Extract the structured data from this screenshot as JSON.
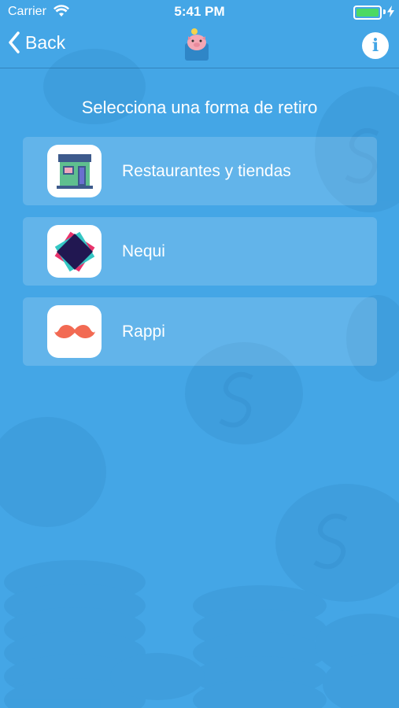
{
  "status_bar": {
    "carrier": "Carrier",
    "time": "5:41 PM",
    "battery_level": 1.0,
    "battery_color": "#4cd964"
  },
  "nav": {
    "back_label": "Back",
    "logo_icon": "piggy-bank-icon",
    "info_label": "i"
  },
  "page": {
    "title": "Selecciona una forma de retiro",
    "background_color": "#44a6e6"
  },
  "options": [
    {
      "label": "Restaurantes y tiendas",
      "icon": "store-icon"
    },
    {
      "label": "Nequi",
      "icon": "nequi-logo-icon"
    },
    {
      "label": "Rappi",
      "icon": "rappi-mustache-icon"
    }
  ]
}
